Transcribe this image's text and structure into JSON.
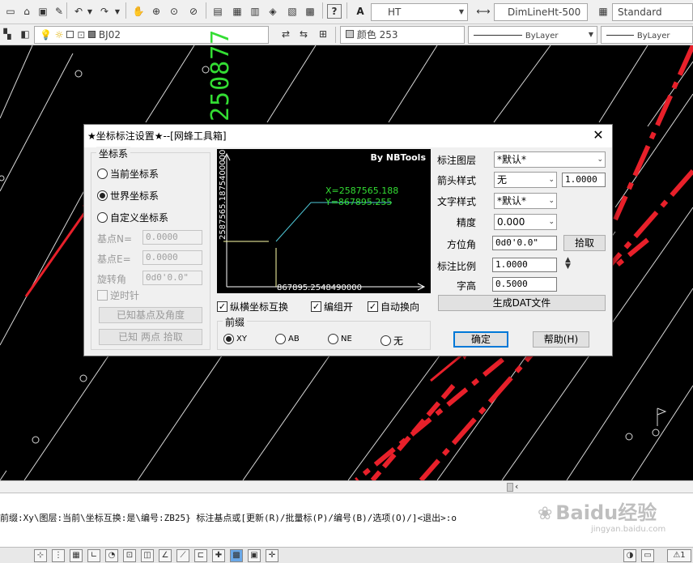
{
  "toolbar1": {
    "icons": [
      "new-icon",
      "open-icon",
      "save-icon",
      "saveas-icon",
      "undo-icon",
      "redo-icon",
      "pan-icon",
      "zoom-window-icon",
      "zoom-icon",
      "zoom-previous-icon",
      "properties-icon",
      "design-center-icon",
      "tool-palette-icon",
      "sheetset-icon",
      "markup-icon",
      "calculator-icon",
      "help-icon"
    ],
    "text_style": "HT",
    "dim_style": "DimLineHt-500",
    "table_style": "Standard"
  },
  "toolbar2": {
    "layer": "BJ02",
    "color": "颜色 253",
    "linetype": "ByLayer",
    "lineweight": "ByLayer"
  },
  "canvas": {
    "vertical_text": "250877"
  },
  "dialog": {
    "title": "★坐标标注设置★--[网蜂工具箱]",
    "close": "✕",
    "coord_group": {
      "title": "坐标系",
      "opt_current": "当前坐标系",
      "opt_world": "世界坐标系",
      "opt_custom": "自定义坐标系",
      "selected": "world",
      "base_n_label": "基点N=",
      "base_n_value": "0.0000",
      "base_e_label": "基点E=",
      "base_e_value": "0.0000",
      "rotate_label": "旋转角",
      "rotate_value": "0d0'0.0\"",
      "ccw_label": "逆时针",
      "btn_known_base": "已知基点及角度",
      "btn_known_two": "已知 两点 拾取"
    },
    "preview": {
      "brand": "By NBTools",
      "x_text": "X=2587565.188",
      "y_text": "Y=867895.255",
      "v_axis_text": "2587565.1875400000",
      "h_axis_text": "867895.2548490000"
    },
    "opts": {
      "swap_label": "纵横坐标互换",
      "group_label": "编组开",
      "auto_dir_label": "自动换向",
      "prefix_title": "前缀",
      "prefix_xy": "XY",
      "prefix_ab": "AB",
      "prefix_ne": "NE",
      "prefix_none": "无",
      "prefix_selected": "XY"
    },
    "right": {
      "layer_label": "标注图层",
      "layer_value": "*默认*",
      "arrow_label": "箭头样式",
      "arrow_value": "无",
      "arrow_size": "1.0000",
      "text_style_label": "文字样式",
      "text_style_value": "*默认*",
      "precision_label": "精度",
      "precision_value": "0.000",
      "azimuth_label": "方位角",
      "azimuth_value": "0d0'0.0\"",
      "pick_label": "拾取",
      "scale_label": "标注比例",
      "scale_value": "1.0000",
      "height_label": "字高",
      "height_value": "0.5000",
      "gen_dat_label": "生成DAT文件",
      "ok_label": "确定",
      "help_label": "帮助(H)"
    }
  },
  "command": {
    "line": "前缀:Xy\\图层:当前\\坐标互换:是\\编号:ZB25} 标注基点或[更新(R)/批量标(P)/编号(B)/选项(O)/]<退出>:o"
  },
  "watermark": {
    "text": "Baidu经验",
    "sub": "jingyan.baidu.com"
  },
  "colors": {
    "canvas_bg": "#000000",
    "accent_red": "#e8202a",
    "green_text": "#33dd33",
    "cyan_line": "#4fc8d8",
    "ok_border": "#0078d7"
  }
}
